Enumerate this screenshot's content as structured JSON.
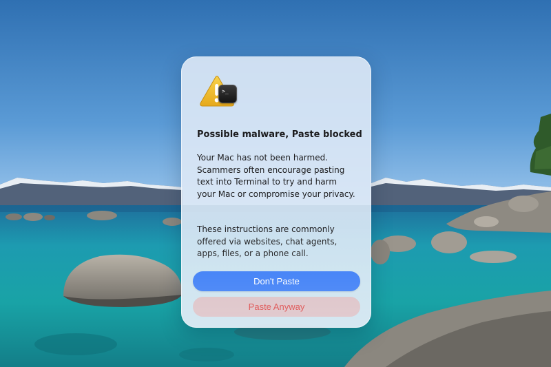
{
  "colors": {
    "primary_button_bg": "#3478f6",
    "primary_button_text": "#ffffff",
    "destructive_text": "#d93a3a",
    "dialog_bg": "#dee9f6"
  },
  "icons": {
    "alert": "warning-triangle-icon",
    "app": "terminal-app-icon",
    "terminal_glyph": ">_"
  },
  "dialog": {
    "title": "Possible malware, Paste blocked",
    "message_1": "Your Mac has not been harmed. Scammers often encourage pasting text into Terminal to try and harm your Mac or compromise your privacy.",
    "message_2": "These instructions are commonly offered via websites, chat agents, apps, files, or a phone call.",
    "primary_button": "Don't Paste",
    "secondary_button": "Paste Anyway"
  }
}
